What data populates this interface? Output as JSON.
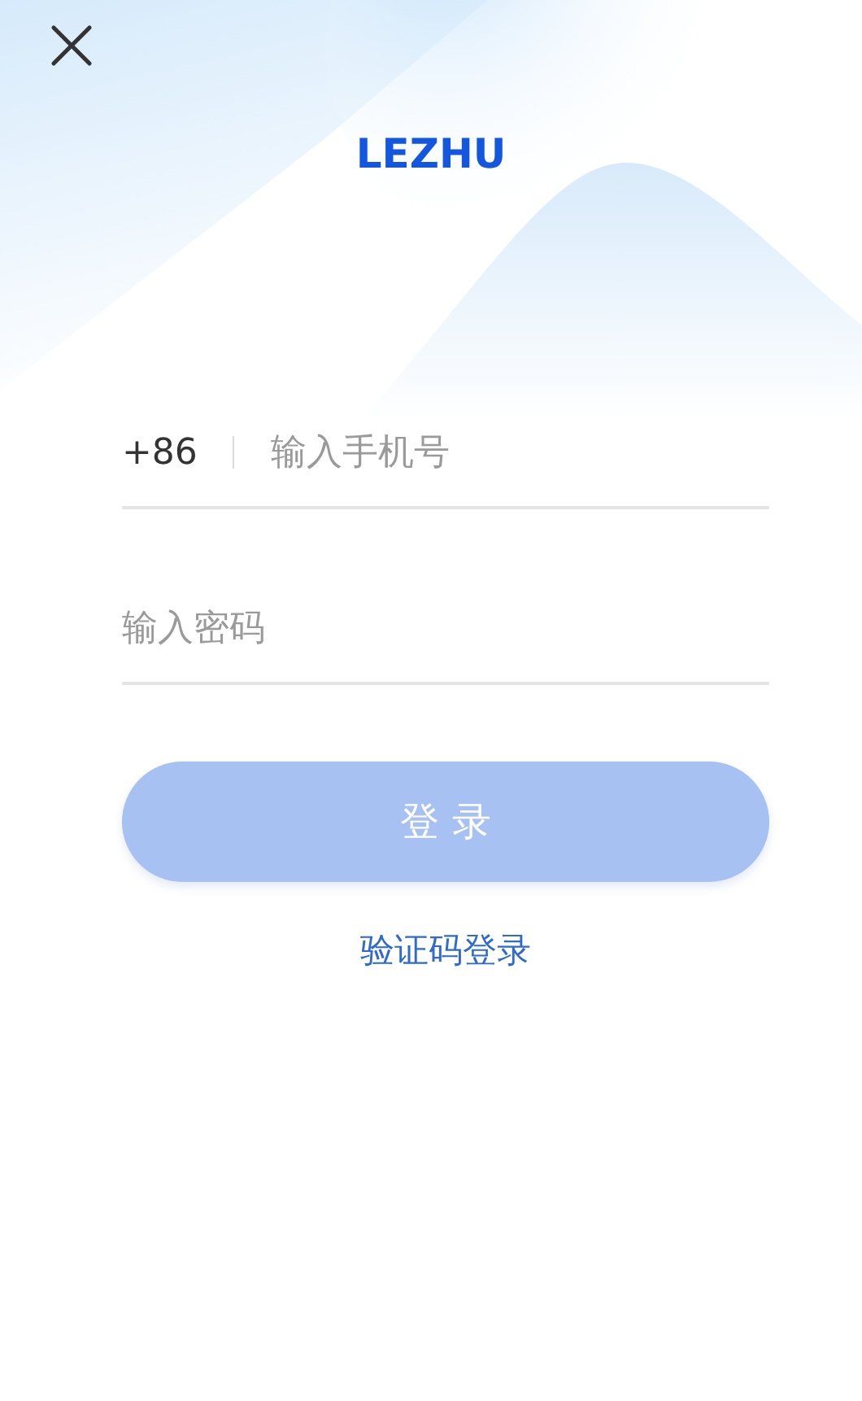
{
  "logo": {
    "text": "LEZHU"
  },
  "phone_field": {
    "country_code": "+86",
    "placeholder": "输入手机号"
  },
  "password_field": {
    "placeholder": "输入密码"
  },
  "login_button": {
    "label": "登 录",
    "disabled": true
  },
  "alt_login_link": {
    "label": "验证码登录"
  }
}
